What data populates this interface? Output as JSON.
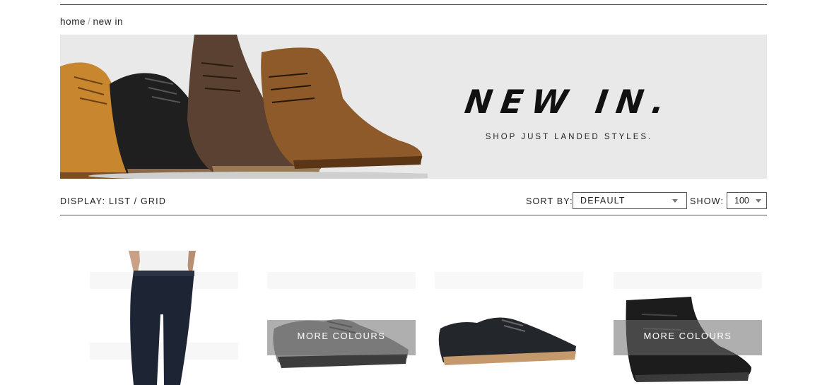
{
  "breadcrumb": {
    "home": "home",
    "separator": "/",
    "current": "new in"
  },
  "banner": {
    "title": "NEW IN.",
    "subtitle": "SHOP JUST LANDED STYLES."
  },
  "toolbar": {
    "display_label": "DISPLAY:",
    "list_label": "LIST",
    "view_separator": "/",
    "grid_label": "GRID",
    "sort_label": "SORT BY:",
    "sort_value": "DEFAULT",
    "show_label": "SHOW:",
    "show_value": "100"
  },
  "products": [
    {
      "overlay": ""
    },
    {
      "overlay": "MORE COLOURS"
    },
    {
      "overlay": ""
    },
    {
      "overlay": "MORE COLOURS"
    }
  ],
  "colors": {
    "background": "#ffffff",
    "banner_bg": "#e9e9e9",
    "rule": "#555555",
    "overlay": "#6e6e6e"
  }
}
